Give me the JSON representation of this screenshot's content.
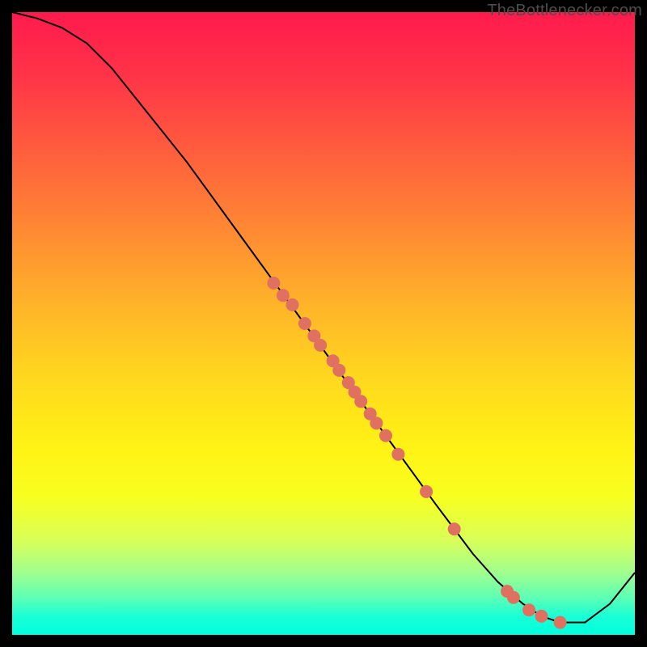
{
  "watermark": "TheBottlenecker.com",
  "chart_data": {
    "type": "line",
    "title": "",
    "xlabel": "",
    "ylabel": "",
    "xlim": [
      0,
      100
    ],
    "ylim": [
      0,
      100
    ],
    "series": [
      {
        "name": "curve",
        "x": [
          0,
          4,
          8,
          12,
          16,
          20,
          28,
          36,
          44,
          52,
          60,
          68,
          74,
          78,
          82,
          85,
          88,
          92,
          96,
          100
        ],
        "y": [
          100,
          99,
          97.5,
          95,
          91,
          86,
          76,
          65,
          54,
          43,
          32,
          21,
          13,
          8.5,
          5,
          3,
          2,
          2,
          5,
          10
        ]
      }
    ],
    "points": [
      {
        "x": 42,
        "y": 56.5
      },
      {
        "x": 43.5,
        "y": 54.5
      },
      {
        "x": 45,
        "y": 53
      },
      {
        "x": 47,
        "y": 50
      },
      {
        "x": 48.5,
        "y": 48
      },
      {
        "x": 49.5,
        "y": 46.5
      },
      {
        "x": 51.5,
        "y": 44
      },
      {
        "x": 52.5,
        "y": 42.5
      },
      {
        "x": 54,
        "y": 40.5
      },
      {
        "x": 55,
        "y": 39
      },
      {
        "x": 56,
        "y": 37.5
      },
      {
        "x": 57.5,
        "y": 35.5
      },
      {
        "x": 58.5,
        "y": 34
      },
      {
        "x": 60,
        "y": 32
      },
      {
        "x": 62,
        "y": 29
      },
      {
        "x": 66.5,
        "y": 23
      },
      {
        "x": 71,
        "y": 17
      },
      {
        "x": 79.5,
        "y": 7
      },
      {
        "x": 80.5,
        "y": 6
      },
      {
        "x": 83,
        "y": 4
      },
      {
        "x": 85,
        "y": 3
      },
      {
        "x": 88,
        "y": 2
      }
    ],
    "colors": {
      "curve": "#000000",
      "points": "#e07060"
    }
  }
}
